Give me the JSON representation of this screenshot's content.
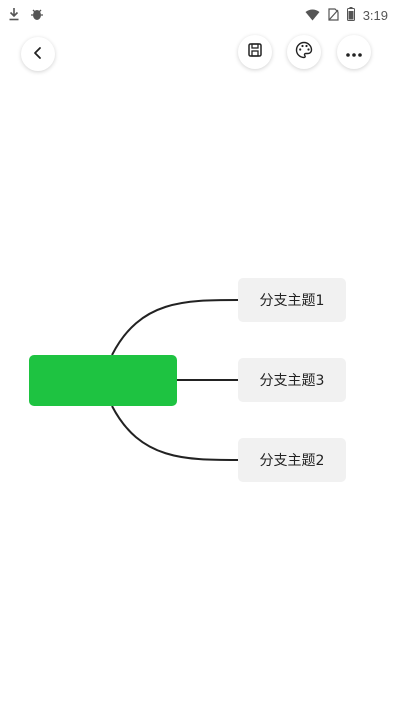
{
  "status_bar": {
    "time": "3:19",
    "left_icons": [
      "download-icon",
      "bug-icon"
    ],
    "right_icons": [
      "wifi-icon",
      "no-sim-icon",
      "battery-icon"
    ]
  },
  "toolbar": {
    "back_icon": "chevron-left-icon",
    "save_icon": "save-icon",
    "theme_icon": "palette-icon",
    "more_icon": "more-icon"
  },
  "mind_map": {
    "root": {
      "label": "",
      "color": "#1ec341"
    },
    "branches": [
      {
        "label": "分支主题1"
      },
      {
        "label": "分支主题3"
      },
      {
        "label": "分支主题2"
      }
    ],
    "connector_color": "#222222"
  }
}
